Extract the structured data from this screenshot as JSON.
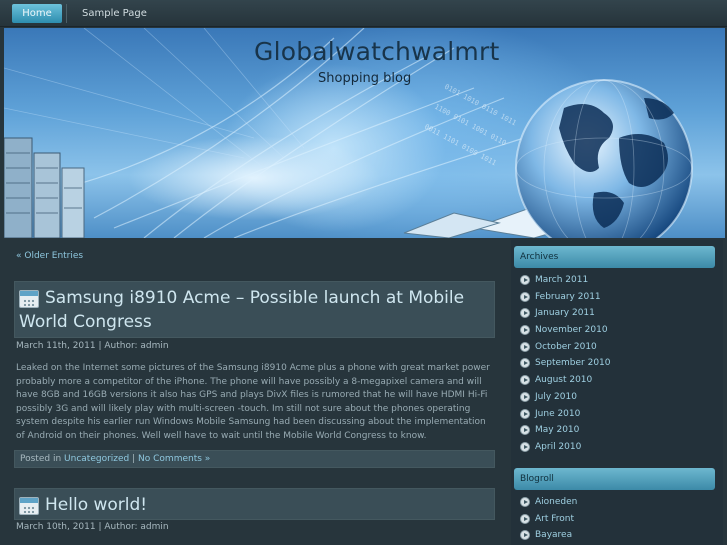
{
  "nav": {
    "items": [
      {
        "label": "Home",
        "active": true
      },
      {
        "label": "Sample Page",
        "active": false
      }
    ]
  },
  "header": {
    "title": "Globalwatchwalmrt",
    "tagline": "Shopping blog"
  },
  "content": {
    "older_entries": "« Older Entries",
    "posts": [
      {
        "title": "Samsung i8910 Acme – Possible launch at Mobile World Congress",
        "meta": "March 11th, 2011 | Author: admin",
        "body": "Leaked on the Internet some pictures of the Samsung i8910 Acme plus a phone with great market power probably more a competitor of the iPhone. The phone will have possibly a 8-megapixel camera and will have 8GB and 16GB versions it also has GPS and plays DivX files is rumored that he will have HDMI Hi-Fi possibly 3G and will likely play with multi-screen -touch. Im still not sure about the phones operating system despite his earlier run Windows Mobile Samsung had been discussing about the implementation of Android on their phones. Well well have to wait until the Mobile World Congress to know.",
        "footer": {
          "posted_in": "Posted in",
          "category": "Uncategorized",
          "separator": "|",
          "comments": "No Comments »"
        }
      },
      {
        "title": "Hello world!",
        "meta": "March 10th, 2011 | Author: admin"
      }
    ]
  },
  "sidebar": {
    "archives": {
      "heading": "Archives",
      "items": [
        "March 2011",
        "February 2011",
        "January 2011",
        "November 2010",
        "October 2010",
        "September 2010",
        "August 2010",
        "July 2010",
        "June 2010",
        "May 2010",
        "April 2010"
      ]
    },
    "blogroll": {
      "heading": "Blogroll",
      "items": [
        "Aioneden",
        "Art Front",
        "Bayarea"
      ]
    }
  },
  "colors": {
    "background": "#27353c",
    "accent": "#4aa3c3",
    "link": "#8ec7de"
  },
  "icons": [
    "calendar-icon",
    "arrow-bullet-icon"
  ]
}
